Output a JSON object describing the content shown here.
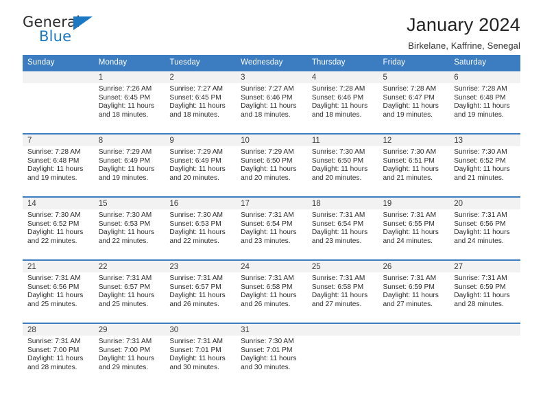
{
  "logo": {
    "name_top": "General",
    "name_bottom": "Blue",
    "triangle_color": "#1b78c2"
  },
  "header": {
    "title": "January 2024",
    "subtitle": "Birkelane, Kaffrine, Senegal"
  },
  "colors": {
    "header_blue": "#3c7cc0",
    "daynum_band": "#f2f2f2",
    "text": "#222222"
  },
  "weekdays": [
    "Sunday",
    "Monday",
    "Tuesday",
    "Wednesday",
    "Thursday",
    "Friday",
    "Saturday"
  ],
  "labels": {
    "sunrise_prefix": "Sunrise:",
    "sunset_prefix": "Sunset:",
    "daylight_prefix": "Daylight:"
  },
  "weeks": [
    [
      {
        "day": "",
        "blank": true,
        "sunrise": "",
        "sunset": "",
        "daylight_1": "",
        "daylight_2": ""
      },
      {
        "day": "1",
        "sunrise": "Sunrise: 7:26 AM",
        "sunset": "Sunset: 6:45 PM",
        "daylight_1": "Daylight: 11 hours",
        "daylight_2": "and 18 minutes."
      },
      {
        "day": "2",
        "sunrise": "Sunrise: 7:27 AM",
        "sunset": "Sunset: 6:45 PM",
        "daylight_1": "Daylight: 11 hours",
        "daylight_2": "and 18 minutes."
      },
      {
        "day": "3",
        "sunrise": "Sunrise: 7:27 AM",
        "sunset": "Sunset: 6:46 PM",
        "daylight_1": "Daylight: 11 hours",
        "daylight_2": "and 18 minutes."
      },
      {
        "day": "4",
        "sunrise": "Sunrise: 7:28 AM",
        "sunset": "Sunset: 6:46 PM",
        "daylight_1": "Daylight: 11 hours",
        "daylight_2": "and 18 minutes."
      },
      {
        "day": "5",
        "sunrise": "Sunrise: 7:28 AM",
        "sunset": "Sunset: 6:47 PM",
        "daylight_1": "Daylight: 11 hours",
        "daylight_2": "and 19 minutes."
      },
      {
        "day": "6",
        "sunrise": "Sunrise: 7:28 AM",
        "sunset": "Sunset: 6:48 PM",
        "daylight_1": "Daylight: 11 hours",
        "daylight_2": "and 19 minutes."
      }
    ],
    [
      {
        "day": "7",
        "sunrise": "Sunrise: 7:28 AM",
        "sunset": "Sunset: 6:48 PM",
        "daylight_1": "Daylight: 11 hours",
        "daylight_2": "and 19 minutes."
      },
      {
        "day": "8",
        "sunrise": "Sunrise: 7:29 AM",
        "sunset": "Sunset: 6:49 PM",
        "daylight_1": "Daylight: 11 hours",
        "daylight_2": "and 19 minutes."
      },
      {
        "day": "9",
        "sunrise": "Sunrise: 7:29 AM",
        "sunset": "Sunset: 6:49 PM",
        "daylight_1": "Daylight: 11 hours",
        "daylight_2": "and 20 minutes."
      },
      {
        "day": "10",
        "sunrise": "Sunrise: 7:29 AM",
        "sunset": "Sunset: 6:50 PM",
        "daylight_1": "Daylight: 11 hours",
        "daylight_2": "and 20 minutes."
      },
      {
        "day": "11",
        "sunrise": "Sunrise: 7:30 AM",
        "sunset": "Sunset: 6:50 PM",
        "daylight_1": "Daylight: 11 hours",
        "daylight_2": "and 20 minutes."
      },
      {
        "day": "12",
        "sunrise": "Sunrise: 7:30 AM",
        "sunset": "Sunset: 6:51 PM",
        "daylight_1": "Daylight: 11 hours",
        "daylight_2": "and 21 minutes."
      },
      {
        "day": "13",
        "sunrise": "Sunrise: 7:30 AM",
        "sunset": "Sunset: 6:52 PM",
        "daylight_1": "Daylight: 11 hours",
        "daylight_2": "and 21 minutes."
      }
    ],
    [
      {
        "day": "14",
        "sunrise": "Sunrise: 7:30 AM",
        "sunset": "Sunset: 6:52 PM",
        "daylight_1": "Daylight: 11 hours",
        "daylight_2": "and 22 minutes."
      },
      {
        "day": "15",
        "sunrise": "Sunrise: 7:30 AM",
        "sunset": "Sunset: 6:53 PM",
        "daylight_1": "Daylight: 11 hours",
        "daylight_2": "and 22 minutes."
      },
      {
        "day": "16",
        "sunrise": "Sunrise: 7:30 AM",
        "sunset": "Sunset: 6:53 PM",
        "daylight_1": "Daylight: 11 hours",
        "daylight_2": "and 22 minutes."
      },
      {
        "day": "17",
        "sunrise": "Sunrise: 7:31 AM",
        "sunset": "Sunset: 6:54 PM",
        "daylight_1": "Daylight: 11 hours",
        "daylight_2": "and 23 minutes."
      },
      {
        "day": "18",
        "sunrise": "Sunrise: 7:31 AM",
        "sunset": "Sunset: 6:54 PM",
        "daylight_1": "Daylight: 11 hours",
        "daylight_2": "and 23 minutes."
      },
      {
        "day": "19",
        "sunrise": "Sunrise: 7:31 AM",
        "sunset": "Sunset: 6:55 PM",
        "daylight_1": "Daylight: 11 hours",
        "daylight_2": "and 24 minutes."
      },
      {
        "day": "20",
        "sunrise": "Sunrise: 7:31 AM",
        "sunset": "Sunset: 6:56 PM",
        "daylight_1": "Daylight: 11 hours",
        "daylight_2": "and 24 minutes."
      }
    ],
    [
      {
        "day": "21",
        "sunrise": "Sunrise: 7:31 AM",
        "sunset": "Sunset: 6:56 PM",
        "daylight_1": "Daylight: 11 hours",
        "daylight_2": "and 25 minutes."
      },
      {
        "day": "22",
        "sunrise": "Sunrise: 7:31 AM",
        "sunset": "Sunset: 6:57 PM",
        "daylight_1": "Daylight: 11 hours",
        "daylight_2": "and 25 minutes."
      },
      {
        "day": "23",
        "sunrise": "Sunrise: 7:31 AM",
        "sunset": "Sunset: 6:57 PM",
        "daylight_1": "Daylight: 11 hours",
        "daylight_2": "and 26 minutes."
      },
      {
        "day": "24",
        "sunrise": "Sunrise: 7:31 AM",
        "sunset": "Sunset: 6:58 PM",
        "daylight_1": "Daylight: 11 hours",
        "daylight_2": "and 26 minutes."
      },
      {
        "day": "25",
        "sunrise": "Sunrise: 7:31 AM",
        "sunset": "Sunset: 6:58 PM",
        "daylight_1": "Daylight: 11 hours",
        "daylight_2": "and 27 minutes."
      },
      {
        "day": "26",
        "sunrise": "Sunrise: 7:31 AM",
        "sunset": "Sunset: 6:59 PM",
        "daylight_1": "Daylight: 11 hours",
        "daylight_2": "and 27 minutes."
      },
      {
        "day": "27",
        "sunrise": "Sunrise: 7:31 AM",
        "sunset": "Sunset: 6:59 PM",
        "daylight_1": "Daylight: 11 hours",
        "daylight_2": "and 28 minutes."
      }
    ],
    [
      {
        "day": "28",
        "sunrise": "Sunrise: 7:31 AM",
        "sunset": "Sunset: 7:00 PM",
        "daylight_1": "Daylight: 11 hours",
        "daylight_2": "and 28 minutes."
      },
      {
        "day": "29",
        "sunrise": "Sunrise: 7:31 AM",
        "sunset": "Sunset: 7:00 PM",
        "daylight_1": "Daylight: 11 hours",
        "daylight_2": "and 29 minutes."
      },
      {
        "day": "30",
        "sunrise": "Sunrise: 7:31 AM",
        "sunset": "Sunset: 7:01 PM",
        "daylight_1": "Daylight: 11 hours",
        "daylight_2": "and 30 minutes."
      },
      {
        "day": "31",
        "sunrise": "Sunrise: 7:30 AM",
        "sunset": "Sunset: 7:01 PM",
        "daylight_1": "Daylight: 11 hours",
        "daylight_2": "and 30 minutes."
      },
      {
        "day": "",
        "blank": true,
        "sunrise": "",
        "sunset": "",
        "daylight_1": "",
        "daylight_2": ""
      },
      {
        "day": "",
        "blank": true,
        "sunrise": "",
        "sunset": "",
        "daylight_1": "",
        "daylight_2": ""
      },
      {
        "day": "",
        "blank": true,
        "sunrise": "",
        "sunset": "",
        "daylight_1": "",
        "daylight_2": ""
      }
    ]
  ]
}
